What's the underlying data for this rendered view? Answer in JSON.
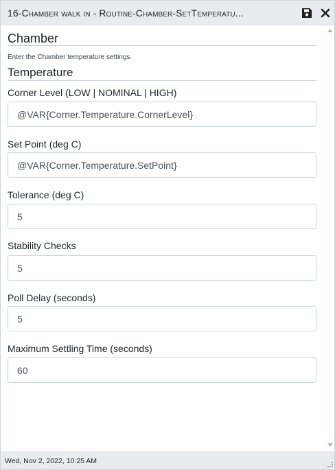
{
  "window": {
    "title": "16-Chamber walk in - Routine-Chamber-SetTemperatu...",
    "save_icon": "save-icon",
    "close_icon": "close-icon"
  },
  "form": {
    "section_title": "Chamber",
    "description": "Enter the Chamber temperature settings.",
    "subsection_title": "Temperature",
    "fields": [
      {
        "label": "Corner Level (LOW | NOMINAL | HIGH)",
        "value": "@VAR{Corner.Temperature.CornerLevel}"
      },
      {
        "label": "Set Point (deg C)",
        "value": "@VAR{Corner.Temperature.SetPoint}"
      },
      {
        "label": "Tolerance (deg C)",
        "value": "5"
      },
      {
        "label": "Stability Checks",
        "value": "5"
      },
      {
        "label": "Poll Delay (seconds)",
        "value": "5"
      },
      {
        "label": "Maximum Settling Time (seconds)",
        "value": "60"
      }
    ]
  },
  "status": {
    "timestamp": "Wed, Nov 2, 2022, 10:25 AM"
  }
}
